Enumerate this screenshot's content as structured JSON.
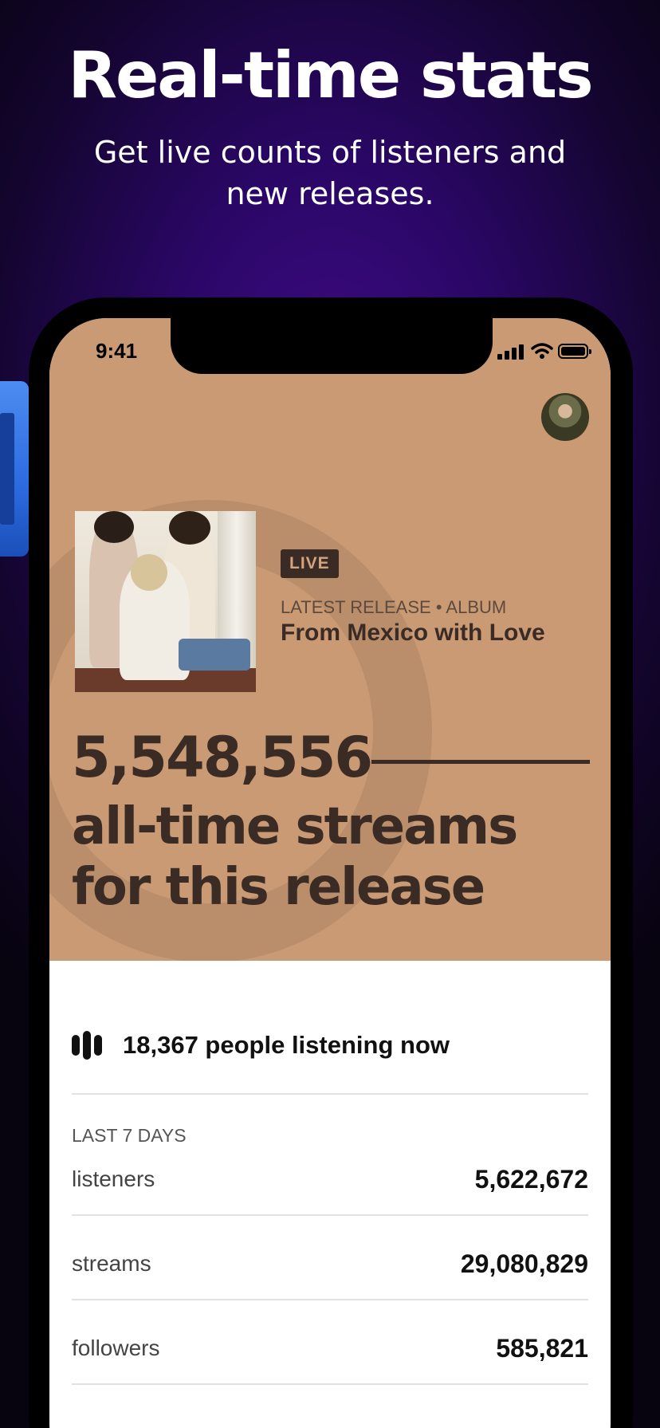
{
  "promo": {
    "headline": "Real-time stats",
    "subheadline": "Get live counts of listeners and new releases."
  },
  "status_bar": {
    "time": "9:41"
  },
  "release": {
    "badge": "LIVE",
    "meta": "LATEST RELEASE • ALBUM",
    "title": "From Mexico with Love",
    "all_time_streams": "5,548,556",
    "caption": "all-time streams for this release"
  },
  "live": {
    "listening_now": "18,367 people listening now"
  },
  "last_7_days": {
    "label": "LAST 7 DAYS",
    "rows": [
      {
        "label": "listeners",
        "value": "5,622,672"
      },
      {
        "label": "streams",
        "value": "29,080,829"
      },
      {
        "label": "followers",
        "value": "585,821"
      }
    ]
  },
  "colors": {
    "hero_background": "#c99a74",
    "hero_text": "#3a2c25",
    "backdrop_purple": "#3f0a86"
  },
  "icons": [
    "cellular-signal-icon",
    "wifi-icon",
    "battery-icon",
    "equalizer-icon"
  ]
}
